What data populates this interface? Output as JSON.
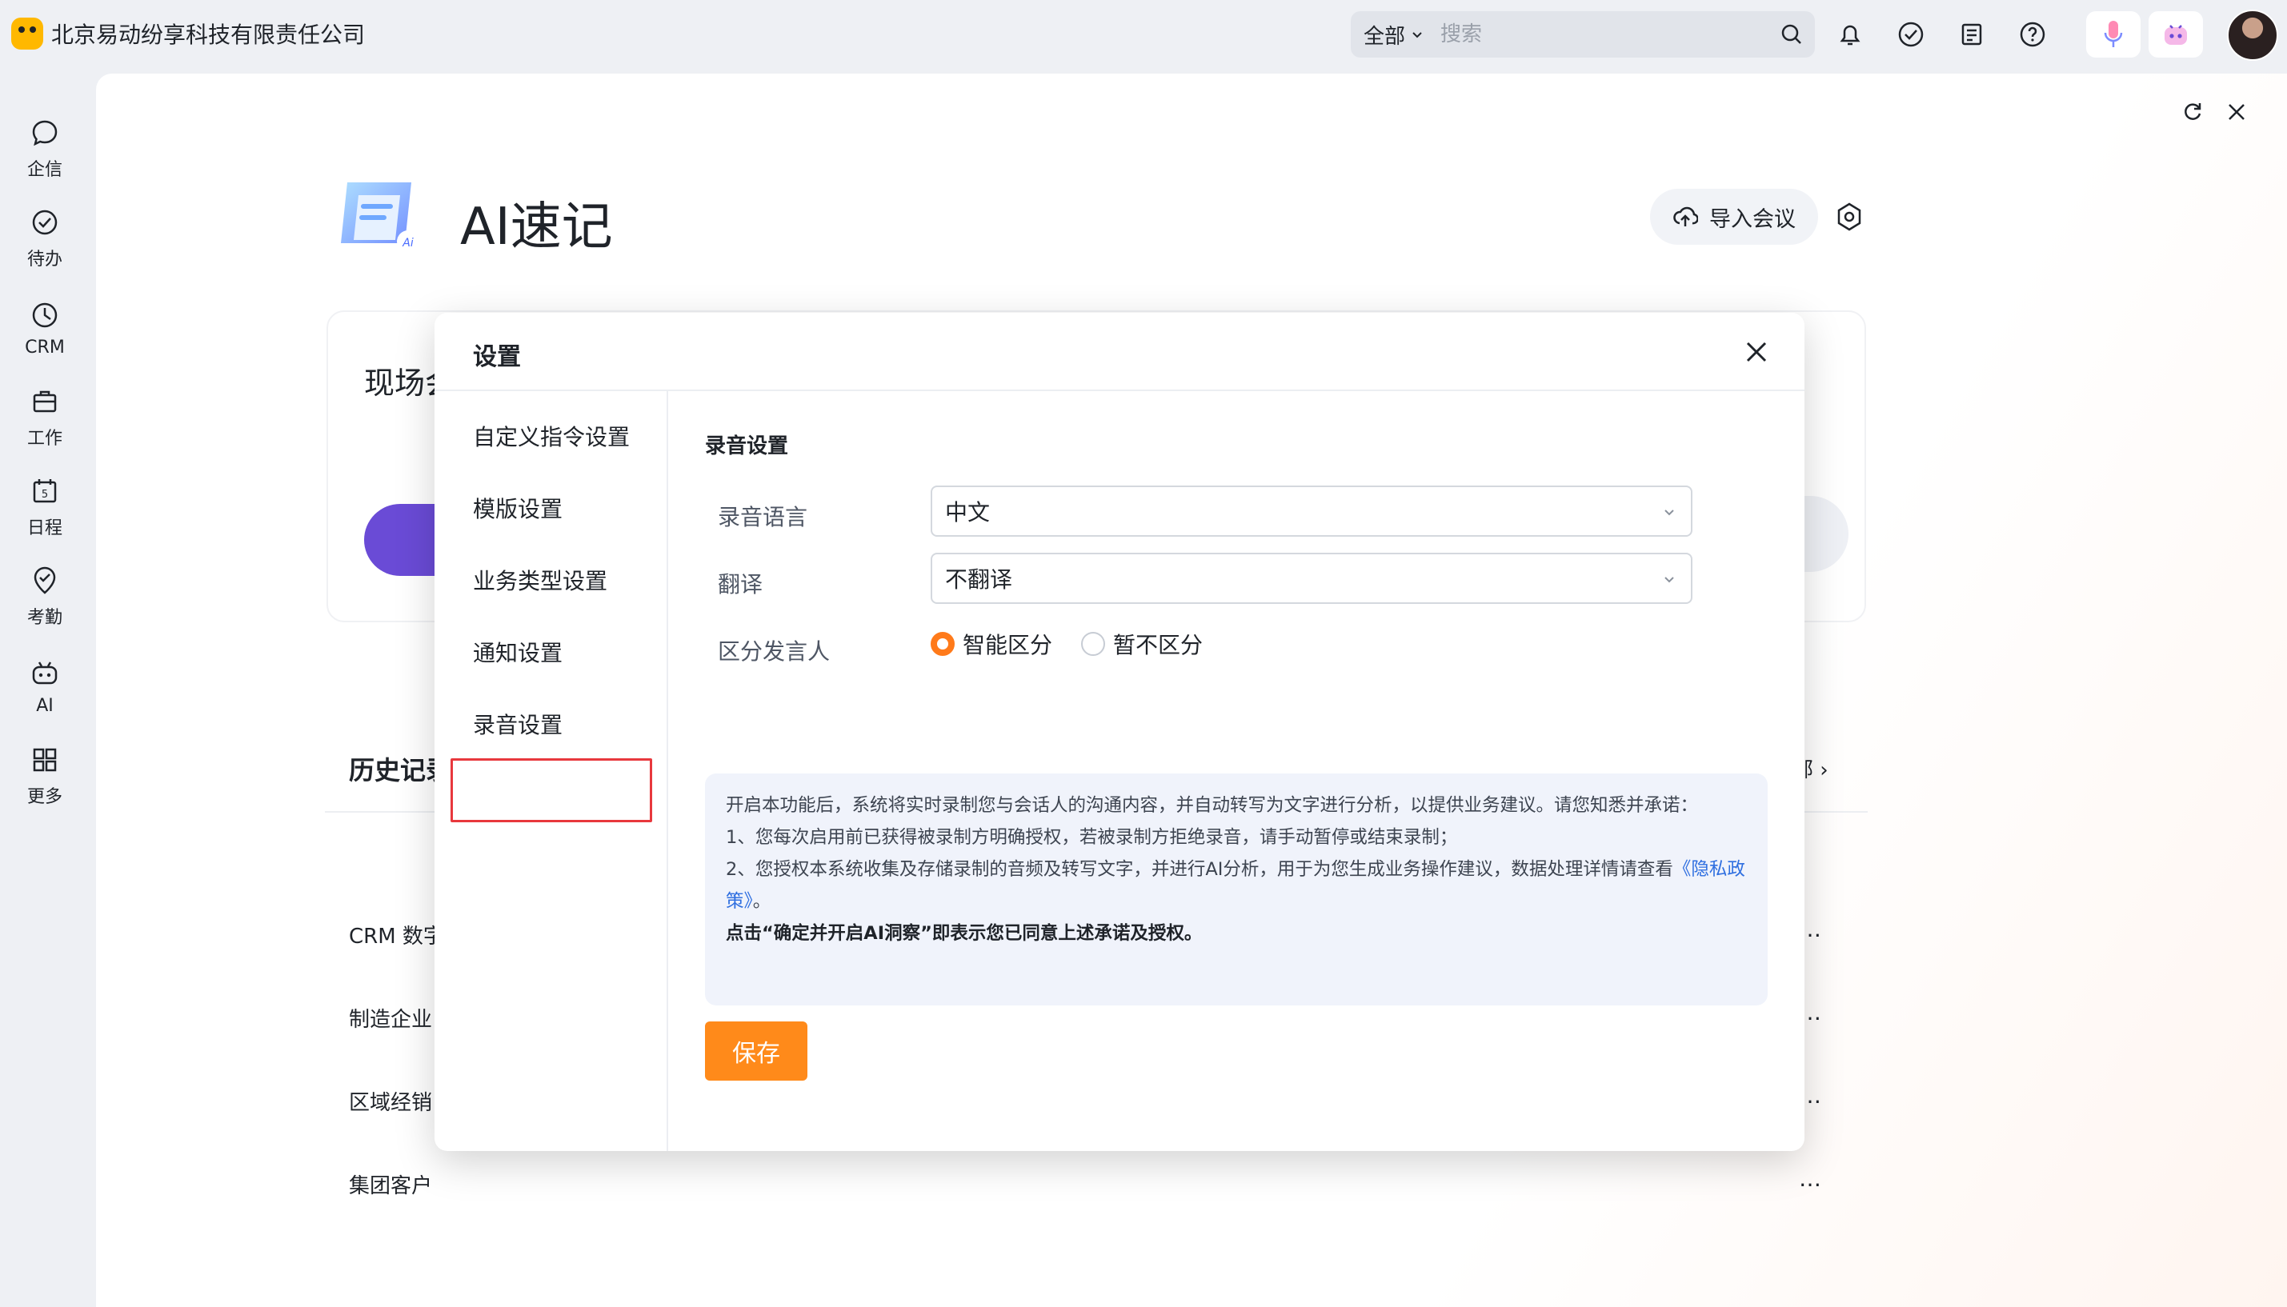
{
  "app": {
    "company": "北京易动纷享科技有限责任公司"
  },
  "search": {
    "scope": "全部",
    "placeholder": "搜索"
  },
  "nav": {
    "items": [
      "企信",
      "待办",
      "CRM",
      "工作",
      "日程",
      "考勤",
      "AI",
      "更多"
    ]
  },
  "main": {
    "title": "AI速记",
    "import_label": "导入会议",
    "card_title": "现场会",
    "history_title": "历史记录",
    "history_all": "部",
    "rows": [
      "CRM 数字",
      "制造企业",
      "区域经销",
      "集团客户"
    ]
  },
  "modal": {
    "title": "设置",
    "sidebar": [
      "自定义指令设置",
      "模版设置",
      "业务类型设置",
      "通知设置",
      "录音设置"
    ],
    "selected": "录音设置",
    "section_title": "录音设置",
    "fields": {
      "language_label": "录音语言",
      "language_value": "中文",
      "translate_label": "翻译",
      "translate_value": "不翻译",
      "speaker_label": "区分发言人",
      "speaker_on": "智能区分",
      "speaker_off": "暂不区分"
    },
    "notice": {
      "p1": "开启本功能后，系统将实时录制您与会话人的沟通内容，并自动转写为文字进行分析，以提供业务建议。请您知悉并承诺：",
      "p2": "1、您每次启用前已获得被录制方明确授权，若被录制方拒绝录音，请手动暂停或结束录制；",
      "p3": "2、您授权本系统收集及存储录制的音频及转写文字，并进行AI分析，用于为您生成业务操作建议，数据处理详情请查看",
      "link": "《隐私政策》",
      "p3_end": "。",
      "confirm": "点击“确定并开启AI洞察”即表示您已同意上述承诺及授权。"
    },
    "save_label": "保存"
  },
  "colors": {
    "accent": "#ff8a1a",
    "highlight": "#e8383d",
    "link": "#2f6fe0"
  }
}
